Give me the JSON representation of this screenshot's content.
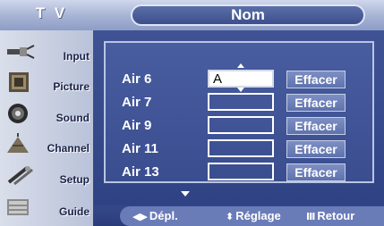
{
  "header": {
    "mode": "T V",
    "title": "Nom"
  },
  "sidebar": {
    "items": [
      {
        "label": "Input",
        "icon": "input-plug-icon"
      },
      {
        "label": "Picture",
        "icon": "picture-icon"
      },
      {
        "label": "Sound",
        "icon": "sound-icon"
      },
      {
        "label": "Channel",
        "icon": "channel-icon"
      },
      {
        "label": "Setup",
        "icon": "setup-icon"
      },
      {
        "label": "Guide",
        "icon": "guide-icon"
      }
    ]
  },
  "main": {
    "rows": [
      {
        "label": "Air 6",
        "value": "A",
        "button": "Effacer",
        "active": true
      },
      {
        "label": "Air 7",
        "value": "",
        "button": "Effacer",
        "active": false
      },
      {
        "label": "Air 9",
        "value": "",
        "button": "Effacer",
        "active": false
      },
      {
        "label": "Air 11",
        "value": "",
        "button": "Effacer",
        "active": false
      },
      {
        "label": "Air 13",
        "value": "",
        "button": "Effacer",
        "active": false
      }
    ]
  },
  "hints": {
    "move": "Dépl.",
    "adjust": "Réglage",
    "back": "Retour"
  },
  "colors": {
    "menu_blue": "#3f5394",
    "accent_light": "#bac5e4",
    "button_blue": "#6c7fb8"
  }
}
